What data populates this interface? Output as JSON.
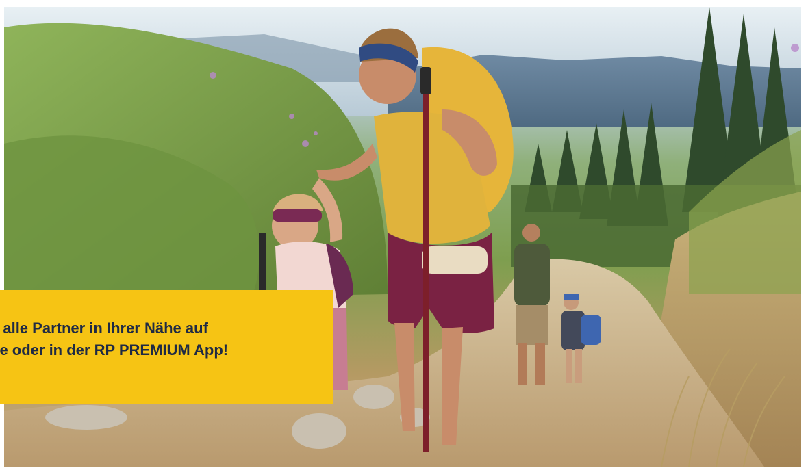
{
  "banner": {
    "line1": "e alle Partner in Ihrer Nähe auf",
    "line2": "de oder in der RP PREMIUM App!",
    "background_color": "#F6C414",
    "text_color": "#1F2A44"
  }
}
